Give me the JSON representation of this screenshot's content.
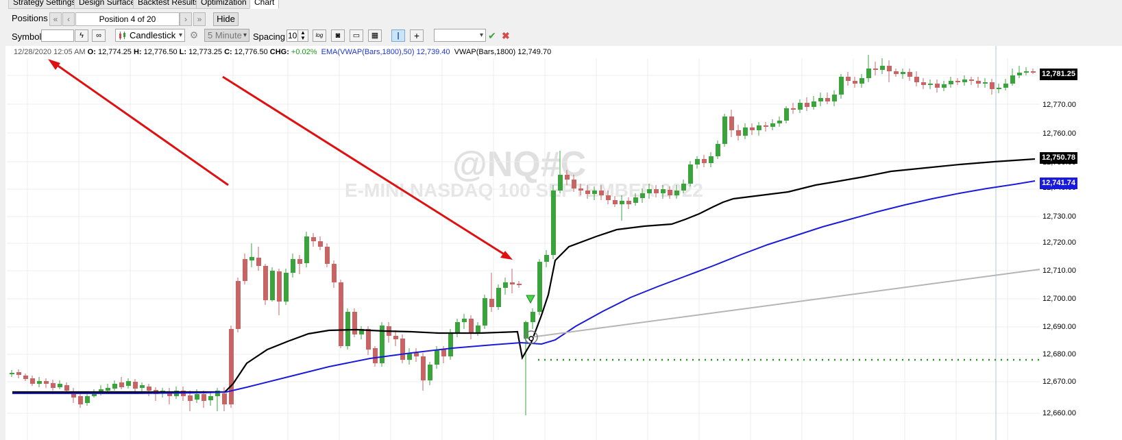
{
  "tabs": [
    {
      "label": "Strategy Settings"
    },
    {
      "label": "Design Surface"
    },
    {
      "label": "Backtest Results"
    },
    {
      "label": "Optimization"
    },
    {
      "label": "Chart"
    }
  ],
  "toolbar": {
    "positions_label": "Positions",
    "position_text": "Position 4 of 20",
    "hide_label": "Hide",
    "symbol_label": "Symbol",
    "symbol_value": "",
    "chart_type": "Candlestick",
    "interval": "5 Minute",
    "spacing_label": "Spacing",
    "spacing_value": "10",
    "log_label": "log"
  },
  "info": {
    "datetime": "12/28/2020 12:05 AM",
    "open_label": "O:",
    "open": "12,774.25",
    "high_label": "H:",
    "high": "12,776.50",
    "low_label": "L:",
    "low": "12,773.25",
    "close_label": "C:",
    "close": "12,776.50",
    "chg_label": "CHG:",
    "chg": "+0.02%",
    "ema_label": "EMA(VWAP(Bars,1800),50)",
    "ema_value": "12,739.40",
    "vwap_label": "VWAP(Bars,1800)",
    "vwap_value": "12,749.70"
  },
  "watermark": {
    "symbol": "@NQ#C",
    "name": "E-MINI NASDAQ 100 SEPTEMBER 2022"
  },
  "axis": {
    "ticks": [
      "12,770.00",
      "12,760.00",
      "12,750.00",
      "12,740.00",
      "12,730.00",
      "12,720.00",
      "12,710.00",
      "12,700.00",
      "12,690.00",
      "12,680.00",
      "12,670.00",
      "12,660.00"
    ],
    "last_price": "12,781.25",
    "vwap_price": "12,750.78",
    "ema_price": "12,741.74"
  },
  "colors": {
    "up": "#3ba33b",
    "down": "#c96464",
    "vwap": "#000000",
    "ema": "#1a1adb",
    "arrow": "#e01010",
    "stop": "#1f9a1f"
  }
}
